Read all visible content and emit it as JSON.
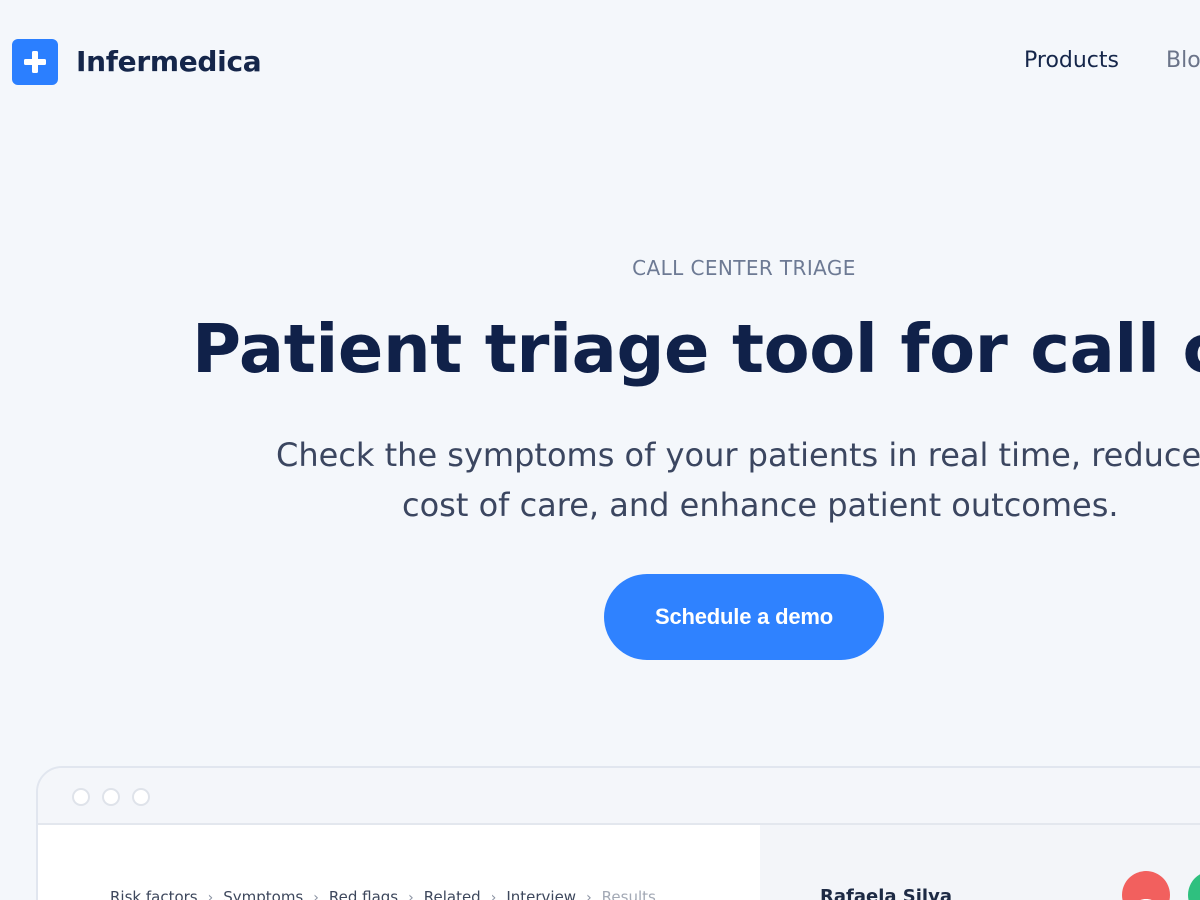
{
  "header": {
    "brand": "Infermedica",
    "logo_icon": "plus-icon",
    "nav": {
      "products": "Products",
      "blog": "Blo"
    }
  },
  "hero": {
    "eyebrow": "CALL CENTER TRIAGE",
    "title": "Patient triage tool for call cente",
    "subtitle_line1": "Check the symptoms of your patients in real time, reduce the",
    "subtitle_line2": "cost of care, and enhance patient outcomes.",
    "cta_label": "Schedule a demo"
  },
  "app_preview": {
    "steps": [
      "Risk factors",
      "Symptoms",
      "Red flags",
      "Related",
      "Interview",
      "Results"
    ],
    "current_step_index": 5,
    "patient_name": "Rafaela Silva",
    "call_end_icon": "phone-hangup-icon",
    "call_accept_icon": "phone-icon"
  },
  "colors": {
    "background": "#f4f7fb",
    "brand_blue": "#2b7fff",
    "cta_blue": "#2f82ff",
    "heading": "#102149",
    "call_end": "#f2605e",
    "call_accept": "#2fc07f"
  }
}
